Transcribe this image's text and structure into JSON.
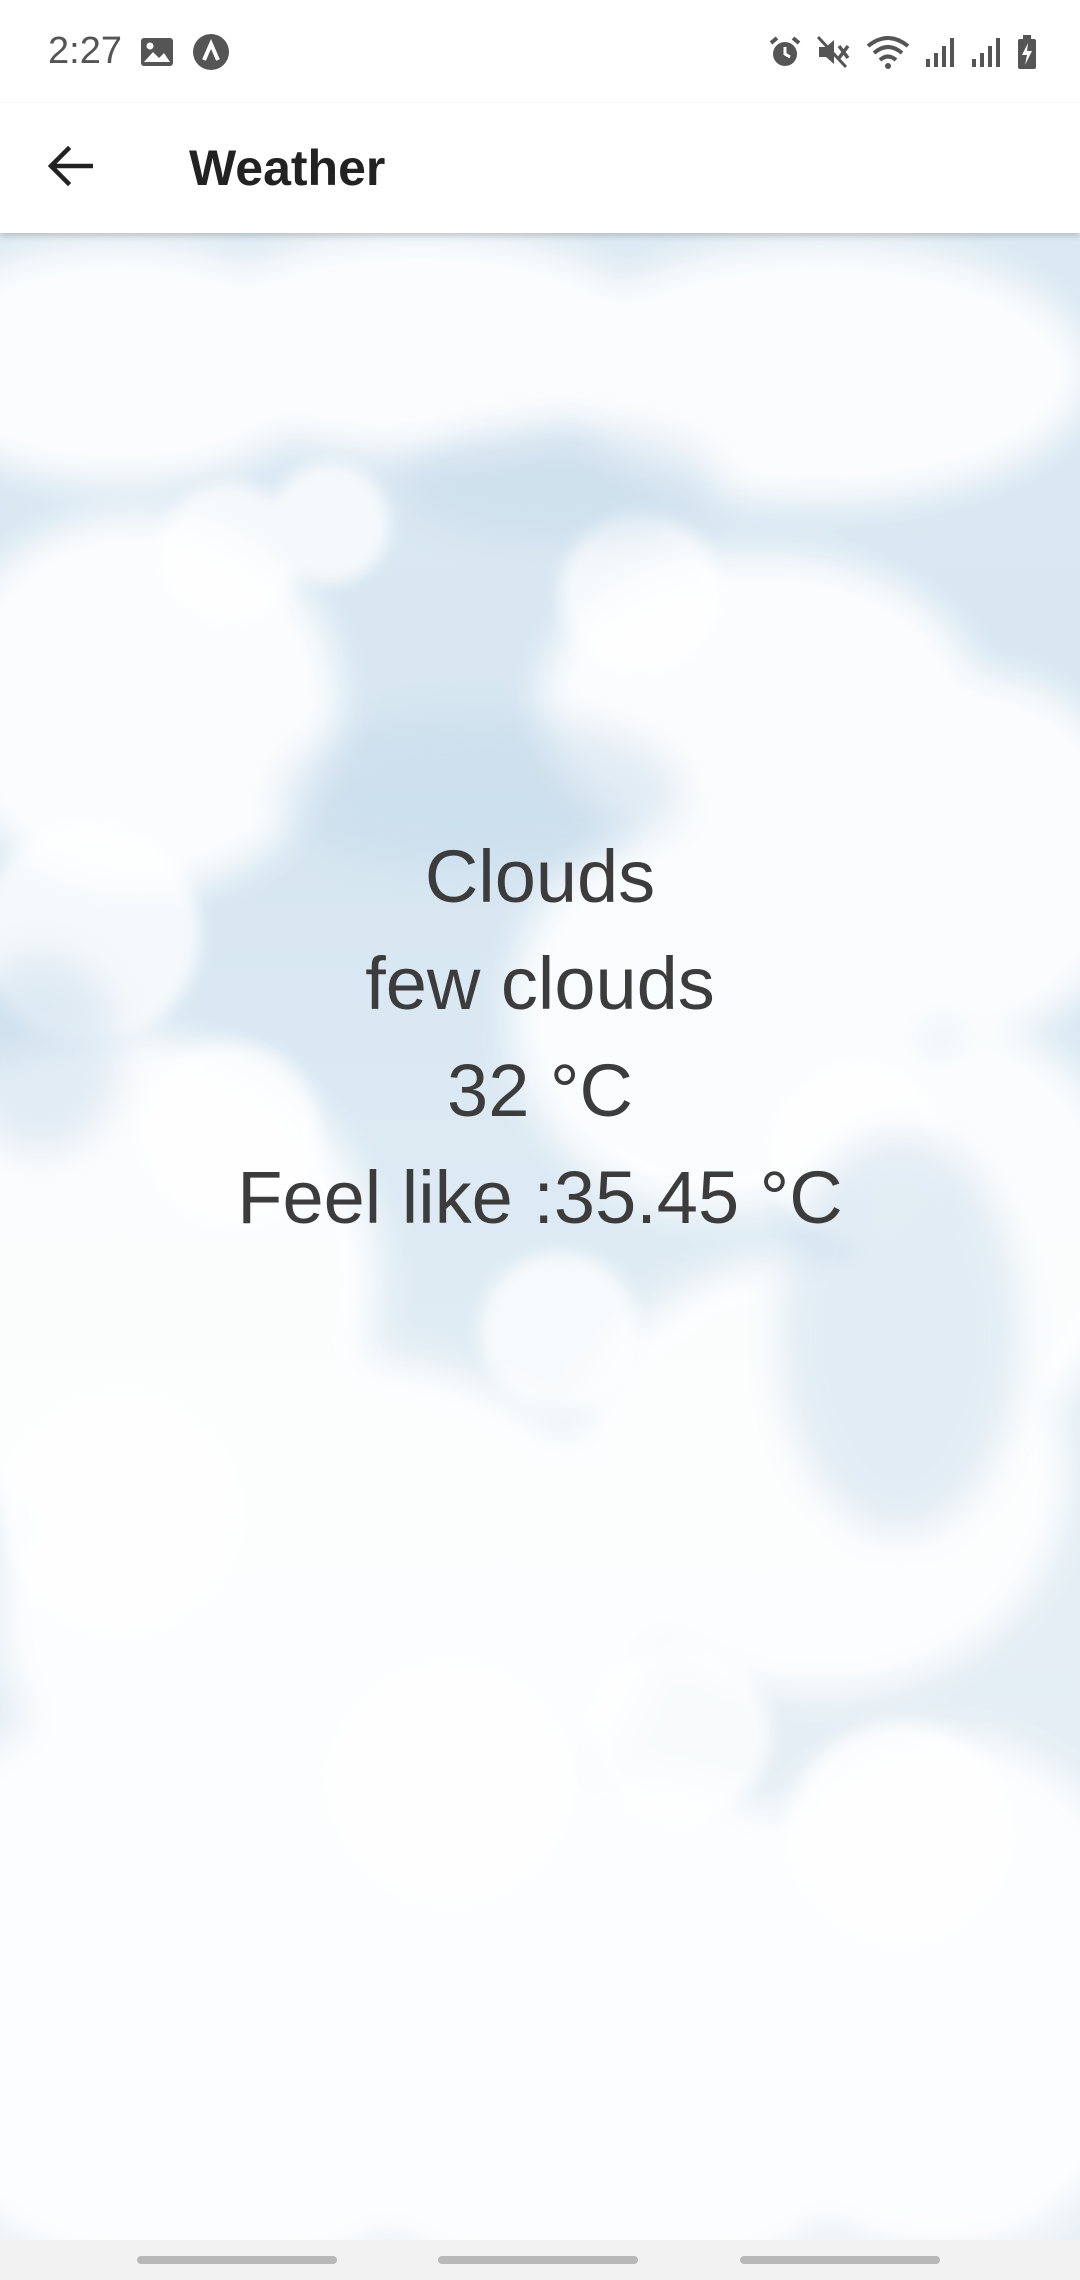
{
  "status_bar": {
    "time": "2:27",
    "left_icons": [
      "image-icon",
      "app-notification-icon"
    ],
    "right_icons": [
      "alarm-icon",
      "mute-icon",
      "wifi-icon",
      "signal-icon",
      "signal-icon",
      "battery-charging-icon"
    ]
  },
  "app_bar": {
    "title": "Weather",
    "back_icon": "arrow-back-icon"
  },
  "weather": {
    "main": "Clouds",
    "description": "few clouds",
    "temperature": "32 °C",
    "feels_like": "Feel like :35.45 °C"
  },
  "colors": {
    "sky": "#d6e6f1",
    "cloud": "#ffffff",
    "text": "#3c3c3c"
  }
}
